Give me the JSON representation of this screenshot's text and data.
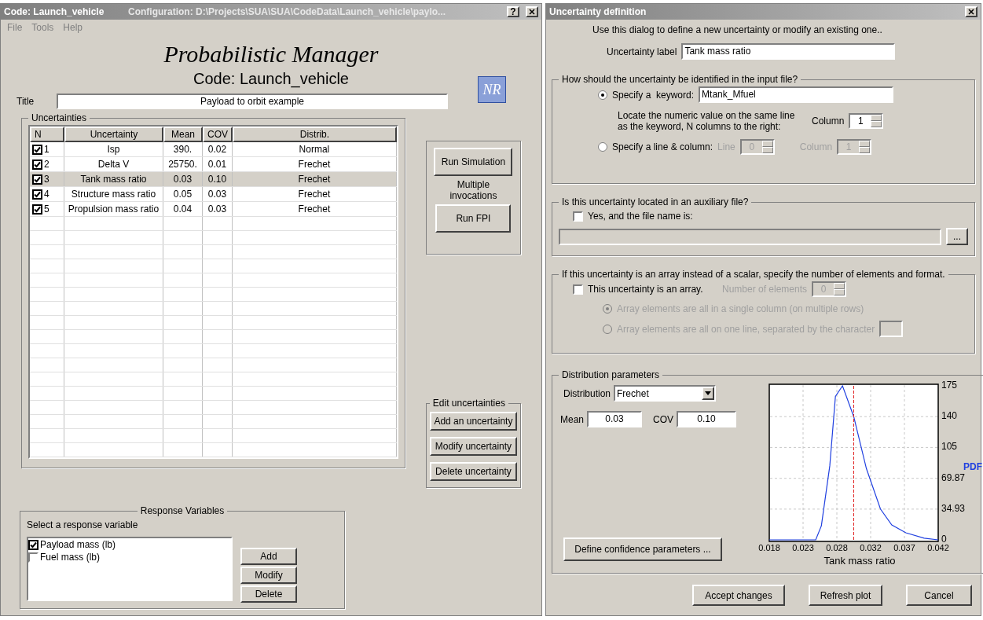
{
  "main_window": {
    "title": "Code: Launch_vehicle",
    "config": "Configuration: D:\\Projects\\SUA\\SUA\\CodeData\\Launch_vehicle\\paylo...",
    "help": "?"
  },
  "menu": [
    "File",
    "Tools",
    "Help"
  ],
  "app_title": "Probabilistic Manager",
  "code_label": "Code: Launch_vehicle",
  "logo": "NR",
  "title_field": {
    "label": "Title",
    "value": "Payload to orbit example"
  },
  "uncertainties": {
    "legend": "Uncertainties",
    "columns": [
      "N",
      "Uncertainty",
      "Mean",
      "COV",
      "Distrib."
    ],
    "rows": [
      {
        "n": "1",
        "checked": true,
        "selected": false,
        "name": "Isp",
        "mean": "390.",
        "cov": "0.02",
        "distrib": "Normal"
      },
      {
        "n": "2",
        "checked": true,
        "selected": false,
        "name": "Delta V",
        "mean": "25750.",
        "cov": "0.01",
        "distrib": "Frechet"
      },
      {
        "n": "3",
        "checked": true,
        "selected": true,
        "name": "Tank mass ratio",
        "mean": "0.03",
        "cov": "0.10",
        "distrib": "Frechet"
      },
      {
        "n": "4",
        "checked": true,
        "selected": false,
        "name": "Structure mass ratio",
        "mean": "0.05",
        "cov": "0.03",
        "distrib": "Frechet"
      },
      {
        "n": "5",
        "checked": true,
        "selected": false,
        "name": "Propulsion mass ratio",
        "mean": "0.04",
        "cov": "0.03",
        "distrib": "Frechet"
      }
    ]
  },
  "run_panel": {
    "run_simulation": "Run Simulation",
    "note": "Multiple invocations",
    "run_fpi": "Run FPI"
  },
  "edit_panel": {
    "legend": "Edit uncertainties",
    "buttons": [
      "Add an uncertainty",
      "Modify uncertainty",
      "Delete uncertainty"
    ]
  },
  "response": {
    "legend": "Response Variables",
    "prompt": "Select a response variable",
    "items": [
      {
        "label": "Payload mass (lb)",
        "checked": true
      },
      {
        "label": "Fuel mass (lb)",
        "checked": false
      }
    ],
    "buttons": [
      "Add",
      "Modify",
      "Delete"
    ]
  },
  "dialog": {
    "title": "Uncertainty definition",
    "intro": "Use this dialog to define a new uncertainty or modify an existing one..",
    "label_field": {
      "label": "Uncertainty label",
      "value": "Tank mass ratio"
    },
    "identify": {
      "legend": "How should the uncertainty be identified in the input file?",
      "keyword": {
        "label": "Specify a  keyword:",
        "selected": true,
        "value": "Mtank_Mfuel"
      },
      "hint": "Locate the numeric value on the same line as the keyword,  N columns to the right:",
      "column": {
        "label": "Column",
        "value": "1",
        "disabled": false
      },
      "line_column": {
        "label": "Specify a line & column:",
        "selected": false
      },
      "line": {
        "label": "Line",
        "value": "0",
        "disabled": true
      },
      "line_col": {
        "label": "Column",
        "value": "1",
        "disabled": true
      }
    },
    "auxiliary": {
      "legend": "Is this uncertainty located in an auxiliary file?",
      "checkbox": {
        "label": "Yes, and the file name is:",
        "checked": false
      },
      "browse": "..."
    },
    "array": {
      "legend": "If this uncertainty is an array instead of a scalar, specify the number of elements and format.",
      "checkbox": {
        "label": "This uncertainty is an array.",
        "checked": false
      },
      "count": {
        "label": "Number of elements",
        "value": "0",
        "disabled": true
      },
      "formats": [
        {
          "label": "Array elements are all in a single column (on multiple rows)",
          "selected": true,
          "disabled": true
        },
        {
          "label": "Array elements are all on one line, separated by the character",
          "selected": false,
          "disabled": true
        }
      ]
    },
    "distribution": {
      "legend": "Distribution parameters",
      "distribution": {
        "label": "Distribution",
        "value": "Frechet"
      },
      "mean": {
        "label": "Mean",
        "value": "0.03"
      },
      "cov": {
        "label": "COV",
        "value": "0.10"
      },
      "confidence_button": "Define confidence parameters ...",
      "chart_data": {
        "type": "line",
        "xlabel": "Tank mass ratio",
        "xlim": [
          0.018,
          0.042
        ],
        "ylim": [
          0,
          175
        ],
        "x": [
          0.018,
          0.023,
          0.0246,
          0.0254,
          0.0266,
          0.0274,
          0.0284,
          0.03,
          0.0318,
          0.0338,
          0.0354,
          0.0374,
          0.04,
          0.042
        ],
        "series": [
          {
            "name": "PDF",
            "color": "#2040e0",
            "values": [
              0,
              0,
              0,
              16,
              84,
              163,
              175,
              140,
              81,
              35,
              17,
              8,
              2,
              0
            ]
          }
        ],
        "xticks": [
          {
            "value": 0.018,
            "label": "0.018"
          },
          {
            "value": 0.0228,
            "label": "0.023"
          },
          {
            "value": 0.0276,
            "label": "0.028"
          },
          {
            "value": 0.0324,
            "label": "0.032"
          },
          {
            "value": 0.0372,
            "label": "0.037"
          },
          {
            "value": 0.042,
            "label": "0.042"
          }
        ],
        "yticks": [
          0,
          {
            "value": 34.93,
            "label": "34.93"
          },
          {
            "value": 69.87,
            "label": "69.87"
          },
          105,
          140,
          175
        ],
        "grid": true,
        "ref_lines": [
          {
            "axis": "x",
            "value": 0.03,
            "color": "#e02020"
          }
        ]
      }
    },
    "buttons": [
      "Accept changes",
      "Refresh plot",
      "Cancel"
    ]
  }
}
